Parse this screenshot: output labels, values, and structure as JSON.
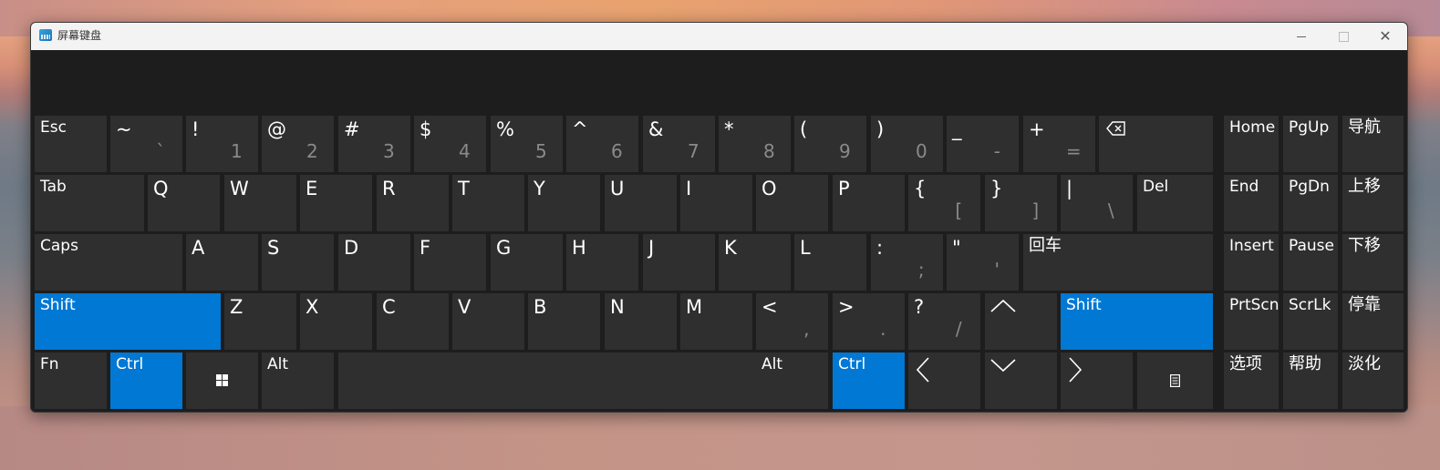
{
  "window": {
    "title": "屏幕键盘",
    "controls": {
      "minimize": "minimize-icon",
      "maximize": "maximize-icon",
      "close": "close-icon"
    }
  },
  "keyboard": {
    "row1": [
      {
        "label": "Esc"
      },
      {
        "label": "~",
        "lower": "`"
      },
      {
        "label": "!",
        "lower": "1"
      },
      {
        "label": "@",
        "lower": "2"
      },
      {
        "label": "#",
        "lower": "3"
      },
      {
        "label": "$",
        "lower": "4"
      },
      {
        "label": "%",
        "lower": "5"
      },
      {
        "label": "^",
        "lower": "6"
      },
      {
        "label": "&",
        "lower": "7"
      },
      {
        "label": "*",
        "lower": "8"
      },
      {
        "label": "(",
        "lower": "9"
      },
      {
        "label": ")",
        "lower": "0"
      },
      {
        "label": "_",
        "lower": "-"
      },
      {
        "label": "+",
        "lower": "="
      },
      {
        "icon": "backspace-icon"
      }
    ],
    "row2": [
      {
        "label": "Tab"
      },
      {
        "label": "Q"
      },
      {
        "label": "W"
      },
      {
        "label": "E"
      },
      {
        "label": "R"
      },
      {
        "label": "T"
      },
      {
        "label": "Y"
      },
      {
        "label": "U"
      },
      {
        "label": "I"
      },
      {
        "label": "O"
      },
      {
        "label": "P"
      },
      {
        "label": "{",
        "lower": "["
      },
      {
        "label": "}",
        "lower": "]"
      },
      {
        "label": "|",
        "lower": "\\"
      },
      {
        "label": "Del"
      }
    ],
    "row3": [
      {
        "label": "Caps"
      },
      {
        "label": "A"
      },
      {
        "label": "S"
      },
      {
        "label": "D"
      },
      {
        "label": "F"
      },
      {
        "label": "G"
      },
      {
        "label": "H"
      },
      {
        "label": "J"
      },
      {
        "label": "K"
      },
      {
        "label": "L"
      },
      {
        "label": ":",
        "lower": ";"
      },
      {
        "label": "\"",
        "lower": "'"
      },
      {
        "label": "回车"
      }
    ],
    "row4": [
      {
        "label": "Shift",
        "active": true
      },
      {
        "label": "Z"
      },
      {
        "label": "X"
      },
      {
        "label": "C"
      },
      {
        "label": "V"
      },
      {
        "label": "B"
      },
      {
        "label": "N"
      },
      {
        "label": "M"
      },
      {
        "label": "<",
        "lower": ","
      },
      {
        "label": ">",
        "lower": "."
      },
      {
        "label": "?",
        "lower": "/"
      },
      {
        "icon": "arrow-up-icon"
      },
      {
        "label": "Shift",
        "active": true
      }
    ],
    "row5": [
      {
        "label": "Fn"
      },
      {
        "label": "Ctrl",
        "active": true
      },
      {
        "icon": "windows-icon"
      },
      {
        "label": "Alt"
      },
      {
        "label": ""
      },
      {
        "label": "Alt"
      },
      {
        "label": "Ctrl",
        "active": true
      },
      {
        "icon": "arrow-left-icon"
      },
      {
        "icon": "arrow-down-icon"
      },
      {
        "icon": "arrow-right-icon"
      },
      {
        "icon": "menu-icon"
      }
    ],
    "side": [
      [
        "Home",
        "PgUp",
        "导航"
      ],
      [
        "End",
        "PgDn",
        "上移"
      ],
      [
        "Insert",
        "Pause",
        "下移"
      ],
      [
        "PrtScn",
        "ScrLk",
        "停靠"
      ],
      [
        "选项",
        "帮助",
        "淡化"
      ]
    ]
  },
  "colors": {
    "key": "#2f2f2f",
    "active": "#0078d4",
    "background": "#1d1d1d",
    "secondary_text": "#8a8a8a"
  }
}
